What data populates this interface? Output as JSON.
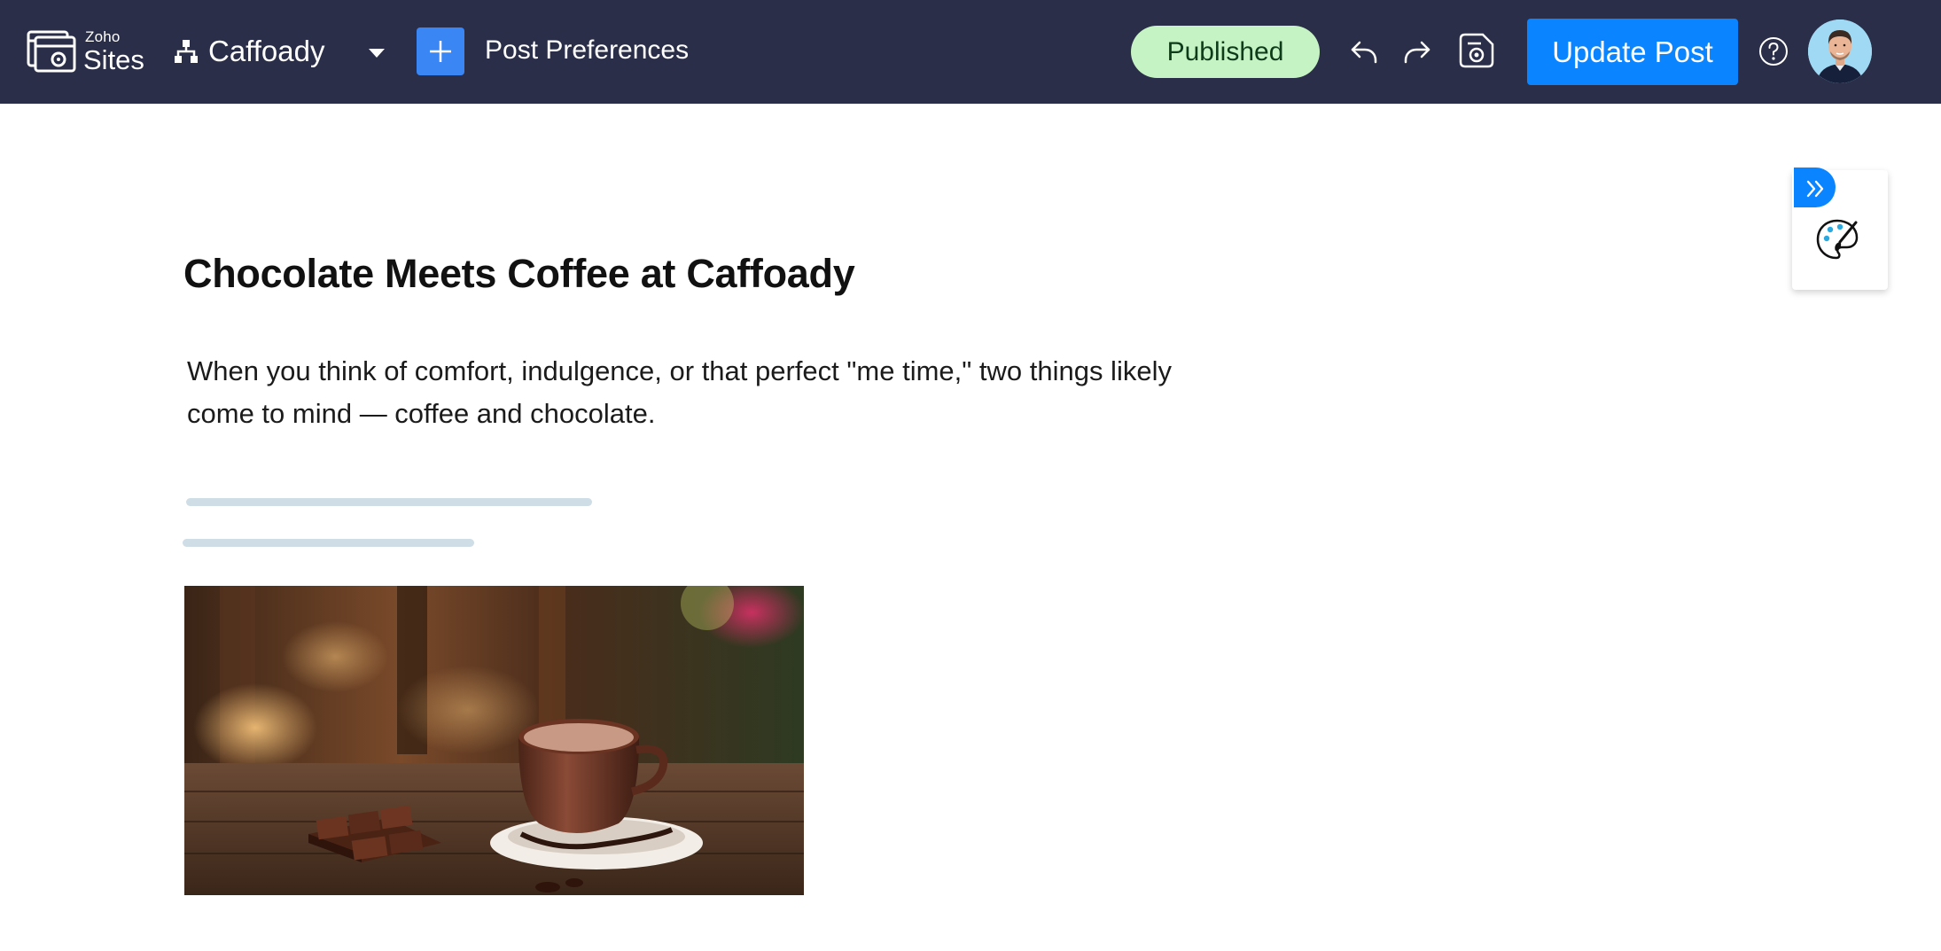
{
  "header": {
    "brand_small": "Zoho",
    "brand_name": "Sites",
    "site_name": "Caffoady",
    "post_preferences_label": "Post Preferences",
    "status_badge": "Published",
    "update_button_label": "Update Post"
  },
  "icons": {
    "logo": "zoho-sites-logo-icon",
    "sitemap": "sitemap-icon",
    "caret": "chevron-down-icon",
    "add": "plus-icon",
    "undo": "undo-icon",
    "redo": "redo-icon",
    "preview": "preview-icon",
    "help": "help-icon",
    "expand": "double-chevron-right-icon",
    "theme": "palette-brush-icon"
  },
  "post": {
    "title": "Chocolate Meets Coffee at Caffoady",
    "intro": "When you think of comfort, indulgence, or that perfect \"me time,\" two things likely come to mind — coffee and chocolate.",
    "image_alt": "Cup of hot cocoa with chocolate pieces on a wooden table"
  },
  "colors": {
    "topbar": "#2a2e48",
    "accent": "#0a84ff",
    "published_badge": "#c6f3c4",
    "skeleton": "#cfdde6"
  }
}
